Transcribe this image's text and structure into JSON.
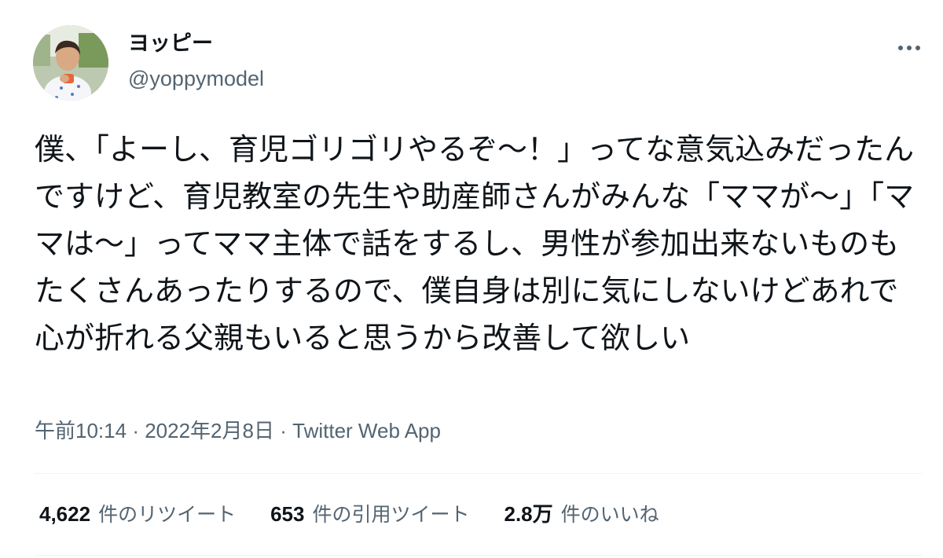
{
  "author": {
    "display_name": "ヨッピー",
    "handle": "@yoppymodel"
  },
  "icons": {
    "avatar": "profile-photo",
    "more": "three-dots-horizontal-icon"
  },
  "tweet": {
    "text": "僕、「よーし、育児ゴリゴリやるぞ〜！」ってな意気込みだったんですけど、育児教室の先生や助産師さんがみんな「ママが〜」「ママは〜」ってママ主体で話をするし、男性が参加出来ないものもたくさんあったりするので、僕自身は別に気にしないけどあれで心が折れる父親もいると思うから改善して欲しい",
    "time": "午前10:14",
    "separator": "·",
    "date": "2022年2月8日",
    "source": "Twitter Web App"
  },
  "stats": {
    "retweets": {
      "count": "4,622",
      "label": "件のリツイート"
    },
    "quotes": {
      "count": "653",
      "label": "件の引用ツイート"
    },
    "likes": {
      "count": "2.8万",
      "label": "件のいいね"
    }
  },
  "colors": {
    "text_primary": "#0f1419",
    "text_secondary": "#536471",
    "divider": "#eff3f4",
    "background": "#ffffff"
  }
}
